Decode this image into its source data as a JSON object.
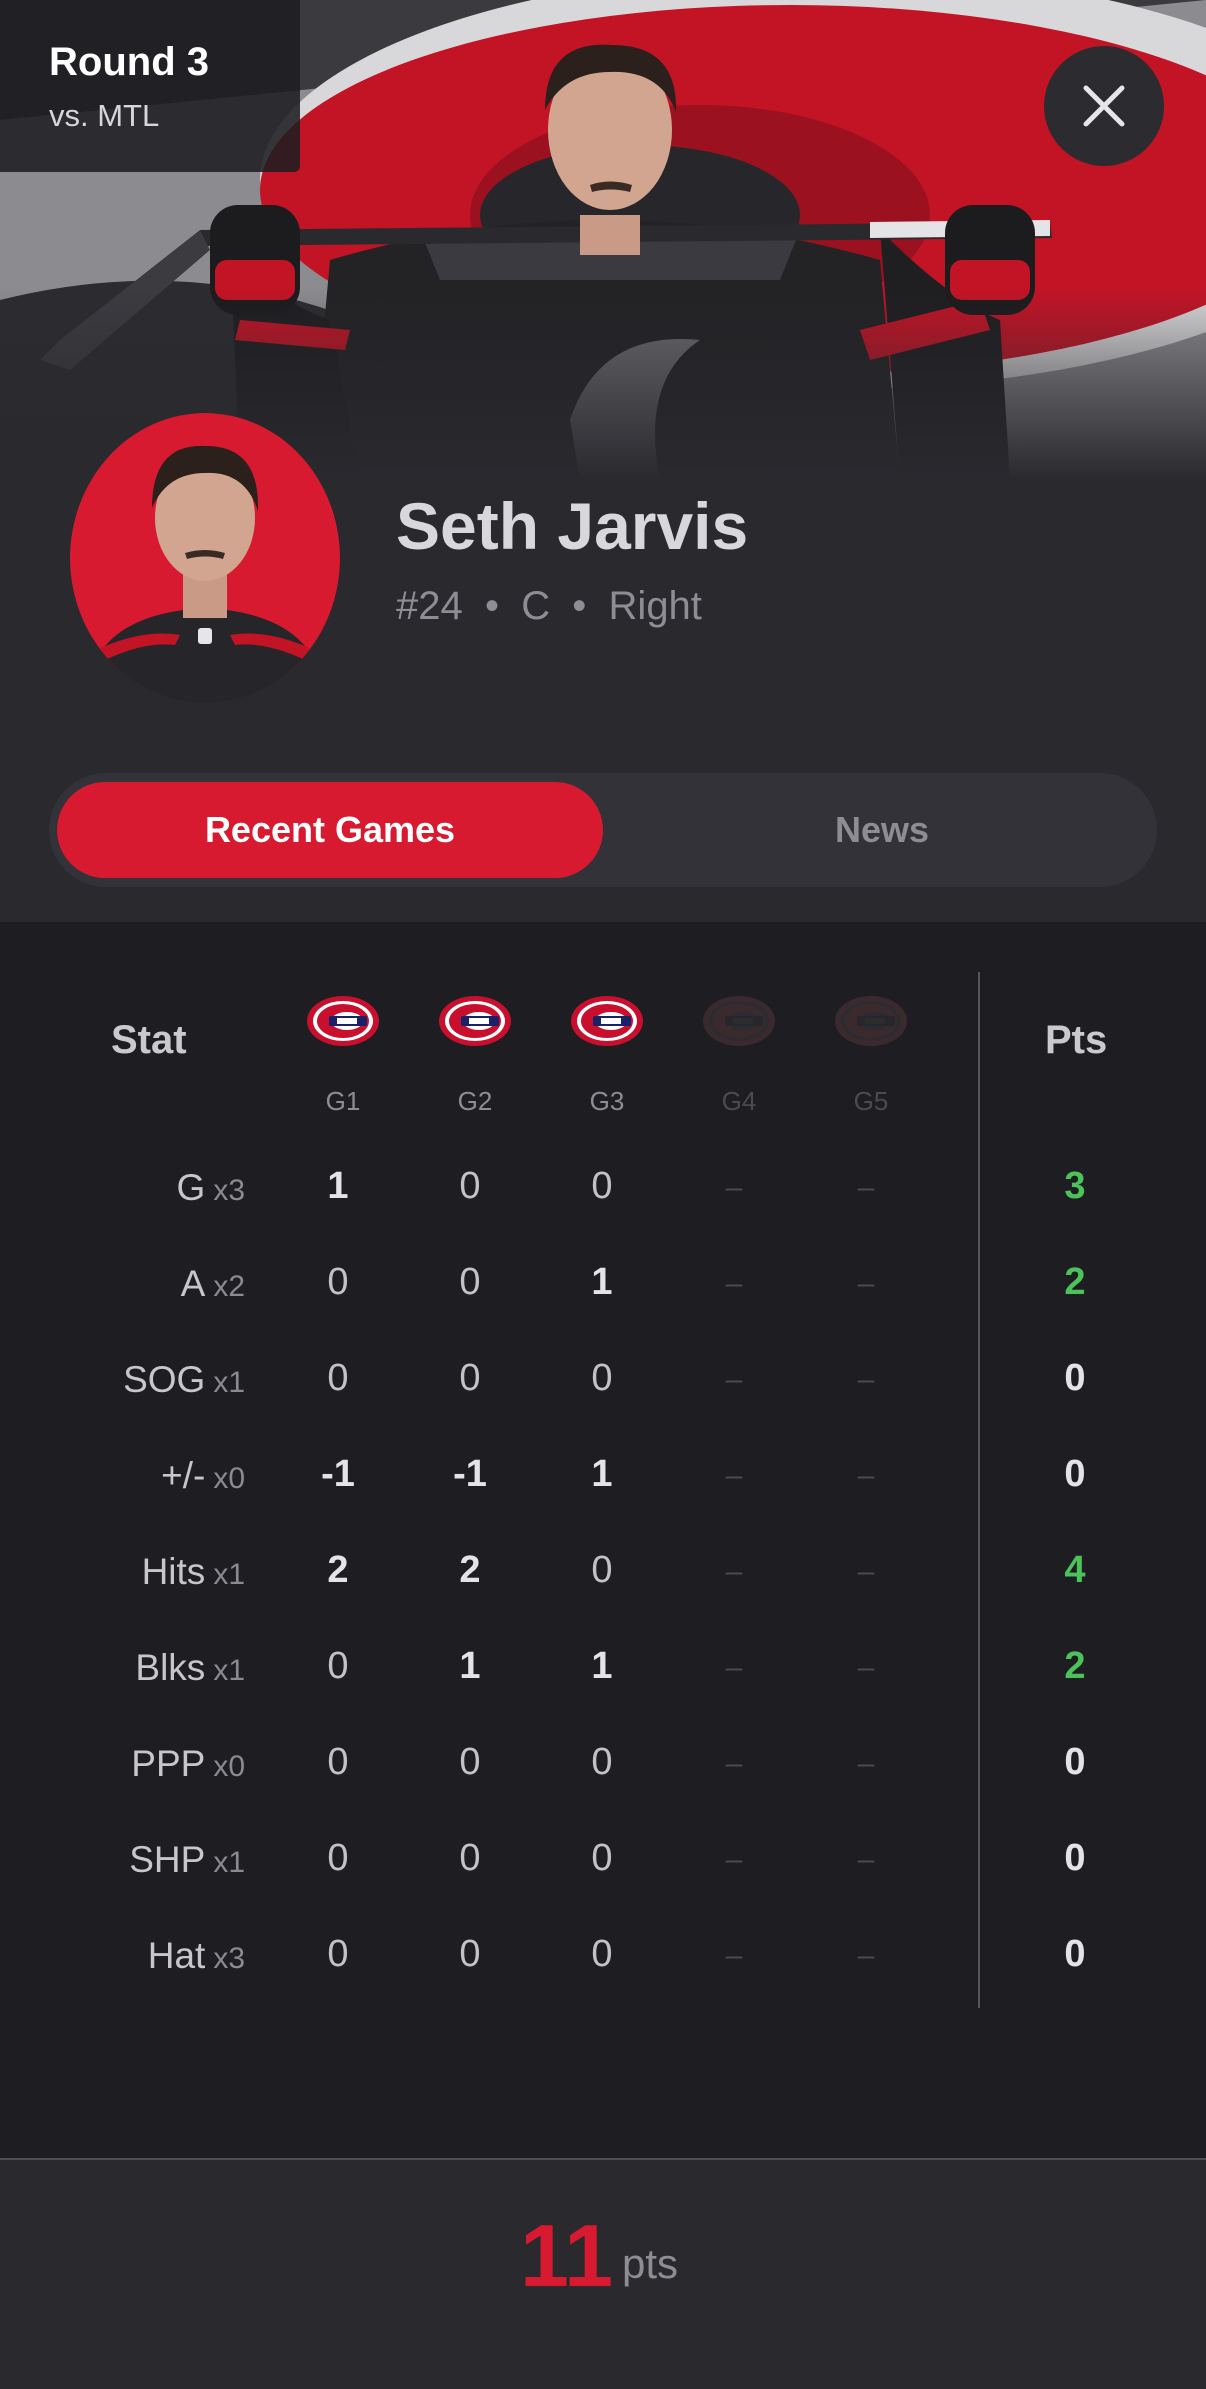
{
  "header": {
    "round_title": "Round 3",
    "opponent": "vs. MTL",
    "close_icon": "close-icon"
  },
  "player": {
    "name": "Seth Jarvis",
    "meta": "#24  •  C  •  Right"
  },
  "tabs": [
    {
      "label": "Recent Games",
      "active": true
    },
    {
      "label": "News",
      "active": false
    }
  ],
  "table": {
    "stat_header": "Stat",
    "pts_header": "Pts",
    "games": [
      {
        "label": "G1",
        "played": true
      },
      {
        "label": "G2",
        "played": true
      },
      {
        "label": "G3",
        "played": true
      },
      {
        "label": "G4",
        "played": false
      },
      {
        "label": "G5",
        "played": false
      }
    ],
    "rows": [
      {
        "name": "G",
        "mult": "x3",
        "values": [
          "1",
          "0",
          "0",
          "–",
          "–"
        ],
        "pts": "3",
        "positive": true
      },
      {
        "name": "A",
        "mult": "x2",
        "values": [
          "0",
          "0",
          "1",
          "–",
          "–"
        ],
        "pts": "2",
        "positive": true
      },
      {
        "name": "SOG",
        "mult": "x1",
        "values": [
          "0",
          "0",
          "0",
          "–",
          "–"
        ],
        "pts": "0",
        "positive": false
      },
      {
        "name": "+/-",
        "mult": "x0",
        "values": [
          "-1",
          "-1",
          "1",
          "–",
          "–"
        ],
        "pts": "0",
        "positive": false
      },
      {
        "name": "Hits",
        "mult": "x1",
        "values": [
          "2",
          "2",
          "0",
          "–",
          "–"
        ],
        "pts": "4",
        "positive": true
      },
      {
        "name": "Blks",
        "mult": "x1",
        "values": [
          "0",
          "1",
          "1",
          "–",
          "–"
        ],
        "pts": "2",
        "positive": true
      },
      {
        "name": "PPP",
        "mult": "x0",
        "values": [
          "0",
          "0",
          "0",
          "–",
          "–"
        ],
        "pts": "0",
        "positive": false
      },
      {
        "name": "SHP",
        "mult": "x1",
        "values": [
          "0",
          "0",
          "0",
          "–",
          "–"
        ],
        "pts": "0",
        "positive": false
      },
      {
        "name": "Hat",
        "mult": "x3",
        "values": [
          "0",
          "0",
          "0",
          "–",
          "–"
        ],
        "pts": "0",
        "positive": false
      }
    ]
  },
  "total": {
    "value": "11",
    "unit": "pts"
  },
  "colors": {
    "accent": "#d71a2f",
    "positive": "#4cc35a",
    "neutral": "#e4e4e8",
    "opponent_red": "#c8102e",
    "opponent_blue": "#192168"
  }
}
